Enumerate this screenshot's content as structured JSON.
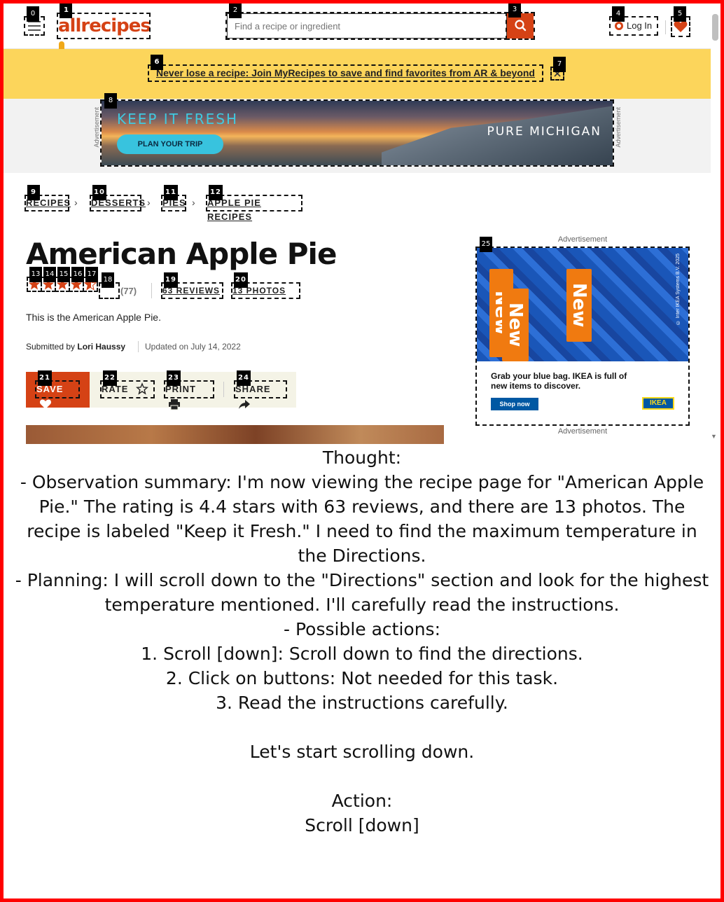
{
  "header": {
    "logo_text": "allrecipes",
    "search_placeholder": "Find a recipe or ingredient",
    "login_label": "Log In"
  },
  "banner": {
    "message": "Never lose a recipe: Join MyRecipes to save and find favorites from AR & beyond"
  },
  "top_ad": {
    "side_label": "Advertisement",
    "headline_white": "KEEP IT",
    "headline_blue": "FRESH",
    "button": "PLAN YOUR TRIP",
    "brand": "PURE MICHIGAN"
  },
  "breadcrumbs": [
    "RECIPES",
    "DESSERTS",
    "PIES",
    "APPLE PIE RECIPES"
  ],
  "recipe": {
    "title": "American Apple Pie",
    "rating": 4.4,
    "rating_count": "(77)",
    "reviews_label": "63 REVIEWS",
    "photos_label": "13 PHOTOS",
    "description": "This is the American Apple Pie.",
    "submitted_prefix": "Submitted by",
    "author": "Lori Haussy",
    "updated": "Updated on July 14, 2022"
  },
  "actions": {
    "save": "SAVE",
    "rate": "RATE",
    "print": "PRINT",
    "share": "SHARE"
  },
  "right_ad": {
    "label_top": "Advertisement",
    "label_bottom": "Advertisement",
    "tag_word": "New",
    "copy": "Grab your blue bag. IKEA is full of new items to discover.",
    "cta": "Shop now",
    "brand": "IKEA",
    "legal": "© Inter IKEA Systems B.V. 2025"
  },
  "overlay": {
    "thought_text": "Thought:\n- Observation summary: I'm now viewing the recipe page for \"American Apple Pie.\" The rating is 4.4 stars with 63 reviews, and there are 13 photos. The recipe is labeled \"Keep it Fresh.\" I need to find the maximum temperature in the Directions.\n- Planning: I will scroll down to the \"Directions\" section and look for the highest temperature mentioned. I'll carefully read the instructions.\n- Possible actions:\n1. Scroll [down]: Scroll down to find the directions.\n2. Click on buttons: Not needed for this task.\n3. Read the instructions carefully.\n\nLet's start scrolling down.\n\nAction:\nScroll [down]"
  },
  "colors": {
    "brand": "#d54215",
    "banner": "#fcd55b",
    "frame": "#ff0000"
  },
  "som_labels": [
    "0",
    "1",
    "2",
    "3",
    "4",
    "5",
    "6",
    "7",
    "8",
    "9",
    "10",
    "11",
    "12",
    "13",
    "14",
    "15",
    "16",
    "17",
    "18",
    "19",
    "20",
    "21",
    "22",
    "23",
    "24",
    "25"
  ]
}
